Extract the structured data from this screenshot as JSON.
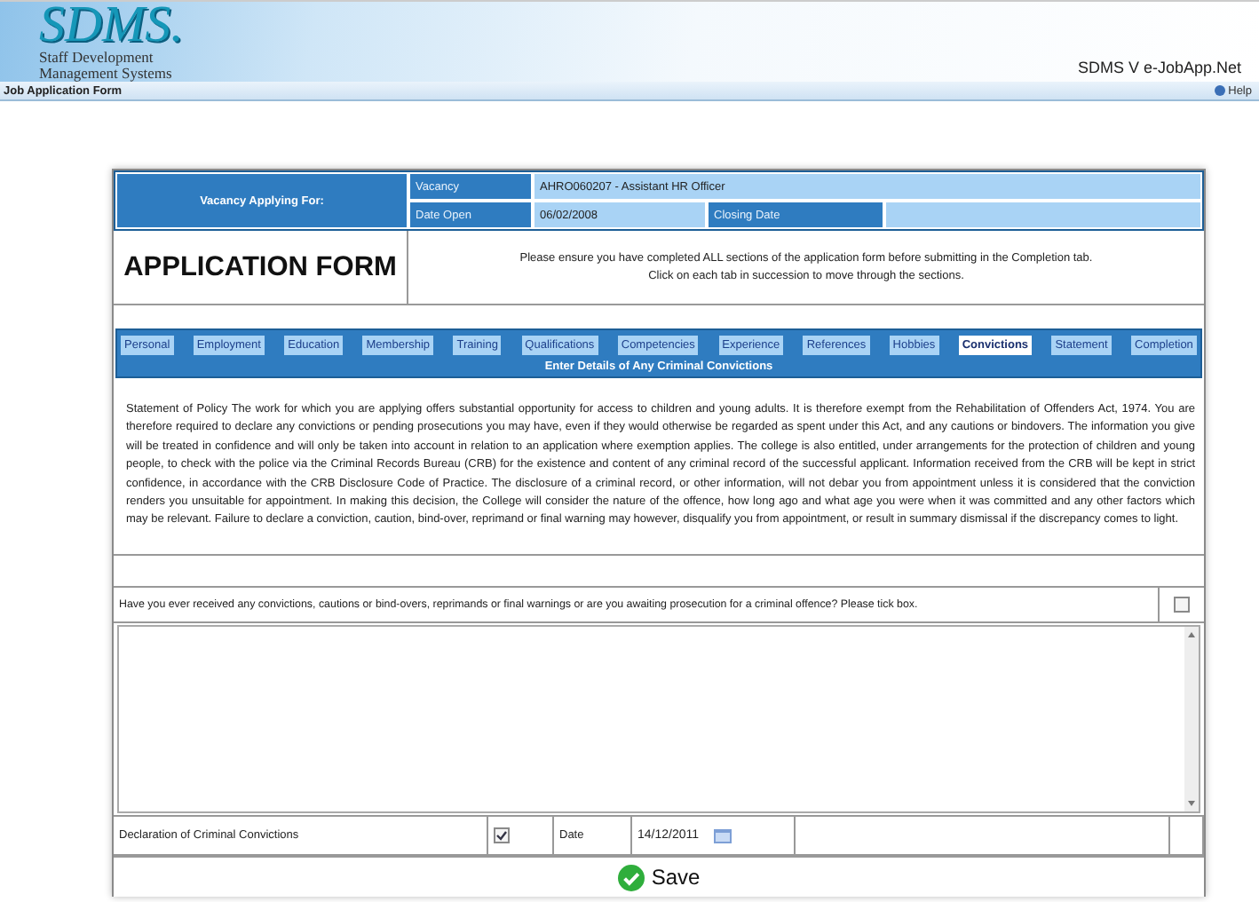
{
  "header": {
    "logo": "SDMS.",
    "logo_subtitle": [
      "Staff Development",
      "Management Systems"
    ],
    "product": "SDMS V e-JobApp.Net"
  },
  "page_bar": {
    "title": "Job Application Form",
    "help": "Help"
  },
  "vacancy": {
    "heading": "Vacancy Applying For:",
    "vacancy_label": "Vacancy",
    "vacancy_value": "AHRO060207 - Assistant HR Officer",
    "date_open_label": "Date Open",
    "date_open_value": "06/02/2008",
    "closing_date_label": "Closing Date"
  },
  "form_title": "APPLICATION FORM",
  "instructions": [
    "Please ensure you have completed ALL sections of the application form before submitting in the Completion tab.",
    "Click on each tab in succession to move through the sections."
  ],
  "tabs": [
    {
      "label": "Personal",
      "selected": false
    },
    {
      "label": "Employment",
      "selected": false
    },
    {
      "label": "Education",
      "selected": false
    },
    {
      "label": "Membership",
      "selected": false
    },
    {
      "label": "Training",
      "selected": false
    },
    {
      "label": "Qualifications",
      "selected": false
    },
    {
      "label": "Competencies",
      "selected": false
    },
    {
      "label": "Experience",
      "selected": false
    },
    {
      "label": "References",
      "selected": false
    },
    {
      "label": "Hobbies",
      "selected": false
    },
    {
      "label": "Convictions",
      "selected": true
    },
    {
      "label": "Statement",
      "selected": false
    },
    {
      "label": "Completion",
      "selected": false
    }
  ],
  "section_title": "Enter Details of Any Criminal Convictions",
  "policy": "Statement of Policy The work for which you are applying offers substantial opportunity for access to children and young adults. It is therefore exempt from the Rehabilitation of Offenders Act, 1974. You are therefore required to declare any convictions or pending prosecutions you may have, even if they would otherwise be regarded as spent under this Act, and any cautions or bindovers. The information you give will be treated in confidence and will only be taken into account in relation to an application where exemption applies. The college is also entitled, under arrangements for the protection of children and young people, to check with the police via the Criminal Records Bureau (CRB) for the existence and content of any criminal record of the successful applicant. Information received from the CRB will be kept in strict confidence, in accordance with the CRB Disclosure Code of Practice. The disclosure of a criminal record, or other information, will not debar you from appointment unless it is considered that the conviction renders you unsuitable for appointment. In making this decision, the College will consider the nature of the offence, how long ago and what age you were when it was committed and any other factors which may be relevant. Failure to declare a conviction, caution, bind-over, reprimand or final warning may however, disqualify you from appointment, or result in summary dismissal if the discrepancy comes to light.",
  "question": {
    "text": "Have you ever received any convictions, cautions or bind-overs, reprimands or final warnings or are you awaiting prosecution for a criminal offence? Please tick box.",
    "checked": false
  },
  "declaration": {
    "label": "Declaration of Criminal Convictions",
    "checked": true,
    "date_label": "Date",
    "date": "14/12/2011"
  },
  "save": "Save"
}
